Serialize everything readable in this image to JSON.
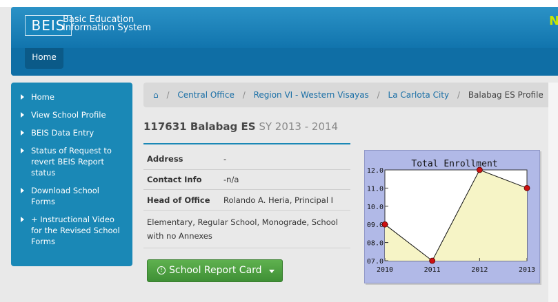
{
  "header": {
    "logo": "BEIS",
    "title_line1": "Basic Education",
    "title_line2": "Information System",
    "corner_text": "N",
    "nav_home": "Home"
  },
  "sidebar": {
    "items": [
      {
        "label": "Home"
      },
      {
        "label": "View School Profile"
      },
      {
        "label": "BEIS Data Entry"
      },
      {
        "label": "Status of Request to revert BEIS Report status"
      },
      {
        "label": "Download School Forms"
      },
      {
        "label": "+ Instructional Video for the Revised School Forms"
      }
    ]
  },
  "breadcrumb": {
    "home_icon": "⌂",
    "items": [
      "Central Office",
      "Region VI - Western Visayas",
      "La Carlota City"
    ],
    "current": "Balabag ES Profile",
    "separator": "/"
  },
  "school": {
    "title": "117631 Balabag ES",
    "sy": "SY 2013 - 2014"
  },
  "info": {
    "address_label": "Address",
    "address_value": "-",
    "contact_label": "Contact Info",
    "contact_value": "-n/a",
    "head_label": "Head of Office",
    "head_value": "Rolando A. Heria, Principal I",
    "description": "Elementary, Regular School, Monograde, School with no Annexes"
  },
  "report_button": {
    "icon": "info-circle-icon",
    "label": "School Report Card"
  },
  "colors": {
    "header_blue": "#1680b8",
    "sidebar_blue": "#1a88b6",
    "button_green": "#4ea243",
    "chart_bg": "#b1b9e7",
    "chart_fill": "#f6f4c6",
    "point_red": "#cc1111"
  },
  "chart_data": {
    "type": "area",
    "title": "Total Enrollment",
    "x": [
      "2010",
      "2011",
      "2012",
      "2013"
    ],
    "y_ticks": [
      "07.0",
      "08.0",
      "09.0",
      "10.0",
      "11.0",
      "12.0"
    ],
    "ylim": [
      7.0,
      12.0
    ],
    "series": [
      {
        "values": [
          9.0,
          7.0,
          12.0,
          11.0
        ]
      }
    ],
    "grid": false,
    "legend": "none"
  }
}
